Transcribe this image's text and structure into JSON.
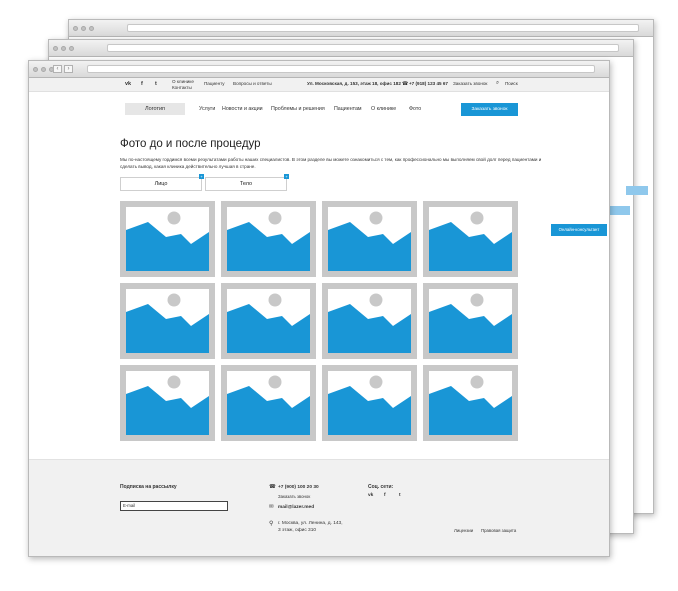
{
  "topbar": {
    "social_icons": [
      "vk-icon",
      "facebook-icon",
      "twitter-icon"
    ],
    "social_glyphs": [
      "vk",
      "f",
      "t"
    ],
    "links": [
      "О клинике",
      "Контакты",
      "Пациенту",
      "Вопросы и ответы"
    ],
    "address": "Ул. Московская, д. 153, этаж 18, офис 182",
    "phone": "+7 (918) 123 45 67",
    "callback": "Заказать звонок",
    "search": "Поиск"
  },
  "header": {
    "logo": "Логотип",
    "nav": [
      "Услуги",
      "Новости и акции",
      "Проблемы и решения",
      "Пациентам",
      "О клинике",
      "Фото"
    ],
    "cta": "Заказать звонок"
  },
  "page": {
    "title": "Фото до и после процедур",
    "intro": "Мы по-настоящему гордимся всеми результатами работы наших специалистов. В этом разделе вы можете ознакомиться с тем, как профессионально мы выполняем свой долг перед пациентами и сделать вывод, какая клиника действительно лучшая в стране.",
    "filters": [
      "Лицо",
      "Тело"
    ],
    "filter_badge": "+"
  },
  "consult_button": "Онлайн-консультант",
  "footer": {
    "subscribe_label": "Подписка на рассылку",
    "email_placeholder": "E-mail",
    "phone": "+7 (900) 100 20 30",
    "callback": "Заказать звонок",
    "email": "mail@lazer.med",
    "address_line1": "г. Москва, ул. Ленина, д. 143,",
    "address_line2": "3 этаж, офис 310",
    "social_label": "Соц. сети:",
    "licenses": "Лицензии",
    "legal": "Правовая защита"
  },
  "colors": {
    "accent": "#1996d6",
    "thumb_frame": "#c8c8c8",
    "footer_bg": "#f1f1f1"
  }
}
